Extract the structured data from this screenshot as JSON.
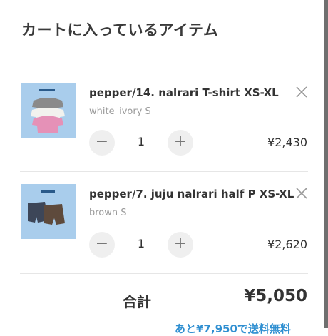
{
  "cart": {
    "title": "カートに入っているアイテム",
    "items": [
      {
        "name": "pepper/14. nalrari T-shirt XS-XL",
        "variant": "white_ivory S",
        "quantity": "1",
        "price": "¥2,430",
        "decrement_icon": "minus-icon",
        "increment_icon": "plus-icon",
        "remove_icon": "close-icon"
      },
      {
        "name": "pepper/7. juju nalrari half P XS-XL",
        "variant": "brown S",
        "quantity": "1",
        "price": "¥2,620",
        "decrement_icon": "minus-icon",
        "increment_icon": "plus-icon",
        "remove_icon": "close-icon"
      }
    ],
    "total_label": "合計",
    "total_value": "¥5,050",
    "shipping_note": "あと¥7,950で送料無料"
  },
  "colors": {
    "thumbnail_bg": "#a9cdec",
    "accent": "#2f8fd1",
    "button_bg": "#efefef"
  }
}
